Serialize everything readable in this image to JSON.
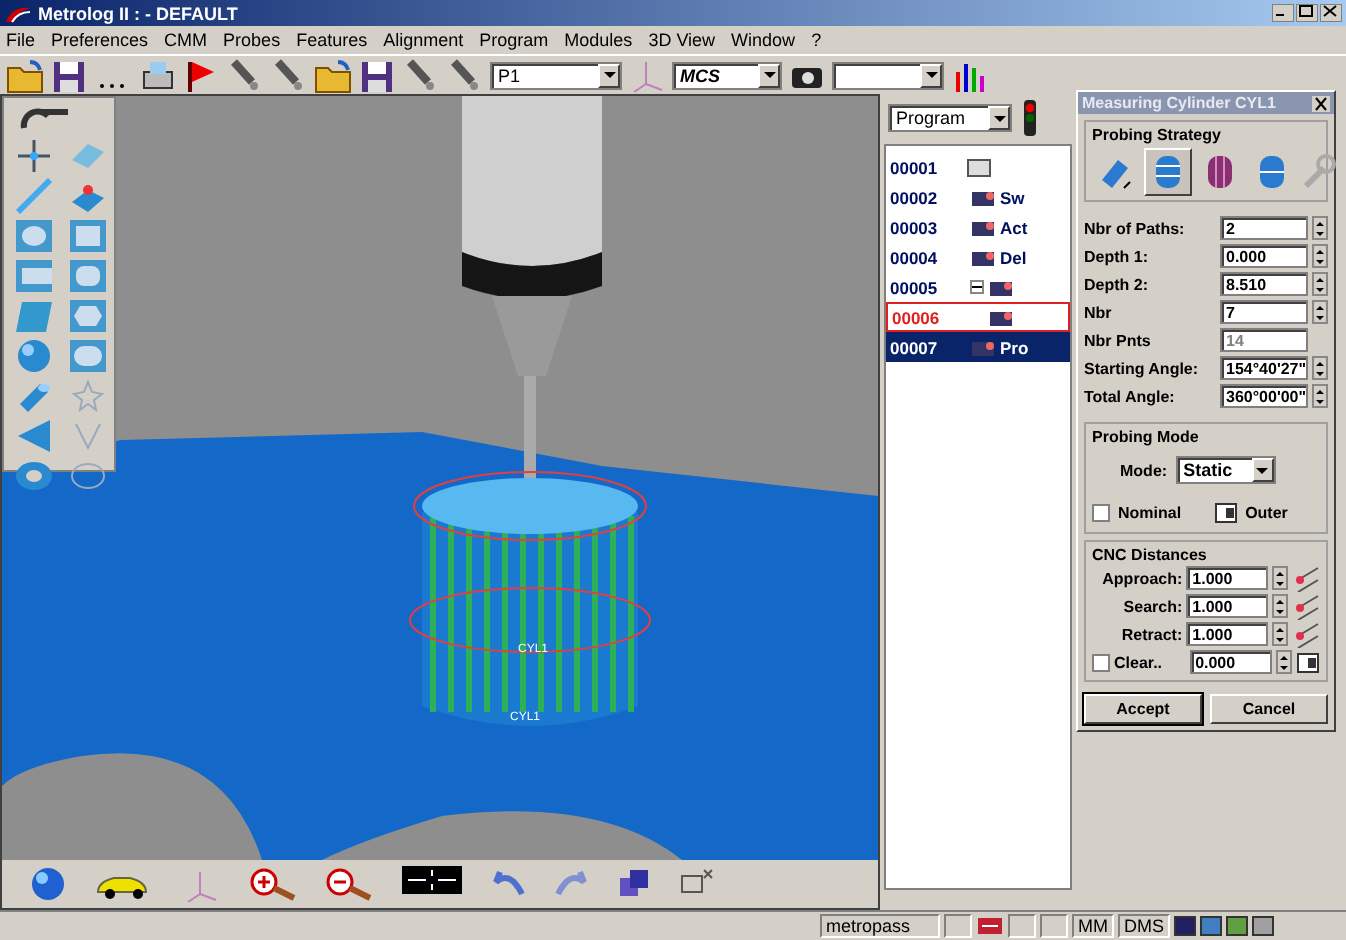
{
  "window": {
    "title": "Metrolog II : - DEFAULT"
  },
  "menu": [
    "File",
    "Preferences",
    "CMM",
    "Probes",
    "Features",
    "Alignment",
    "Program",
    "Modules",
    "3D View",
    "Window",
    "?"
  ],
  "toolbar": {
    "probe": "P1",
    "frame": "MCS"
  },
  "viewport": {
    "labels": [
      "CYL1",
      "CYL1"
    ]
  },
  "program": {
    "dropdown": "Program",
    "rows": [
      {
        "number": "00001",
        "selected": false,
        "highlighted": false,
        "children": [
          {
            "number": "00002",
            "label": "Sw",
            "selected": false,
            "highlighted": false
          },
          {
            "number": "00003",
            "label": "Act",
            "selected": false,
            "highlighted": false
          },
          {
            "number": "00004",
            "label": "Del",
            "selected": false,
            "highlighted": false
          },
          {
            "number": "00005",
            "selected": false,
            "highlighted": false,
            "expanded": true,
            "children": [
              {
                "number": "00006",
                "selected": false,
                "highlighted": true
              }
            ]
          },
          {
            "number": "00007",
            "label": "Pro",
            "selected": true,
            "highlighted": false
          }
        ]
      }
    ]
  },
  "dialog": {
    "title": "Measuring Cylinder CYL1",
    "strategy": {
      "title": "Probing Strategy",
      "options": [
        {
          "selected": false
        },
        {
          "selected": true
        },
        {
          "selected": false
        },
        {
          "selected": false
        }
      ]
    },
    "fields": [
      {
        "label": "Nbr of Paths:",
        "value": "2",
        "disabled": false
      },
      {
        "label": "Depth 1:",
        "value": "0.000",
        "disabled": false
      },
      {
        "label": "Depth 2:",
        "value": "8.510",
        "disabled": false
      },
      {
        "label": "Nbr",
        "value": "7",
        "disabled": false
      },
      {
        "label": "Nbr Pnts",
        "value": "14",
        "disabled": true
      },
      {
        "label": "Starting Angle:",
        "value": "154°40'27\"",
        "disabled": false
      },
      {
        "label": "Total Angle:",
        "value": "360°00'00\"",
        "disabled": false
      }
    ],
    "probing_mode": {
      "title": "Probing Mode",
      "mode_label": "Mode:",
      "mode": "Static",
      "nominal": {
        "label": "Nominal",
        "checked": false
      },
      "side": "Outer"
    },
    "cnc": {
      "title": "CNC Distances",
      "rows": [
        {
          "label": "Approach:",
          "value": "1.000"
        },
        {
          "label": "Search:",
          "value": "1.000"
        },
        {
          "label": "Retract:",
          "value": "1.000"
        }
      ],
      "clear": {
        "label": "Clear..",
        "checked": false,
        "value": "0.000"
      }
    },
    "buttons": [
      {
        "label": "Accept",
        "default": true
      },
      {
        "label": "Cancel",
        "default": false
      }
    ]
  },
  "status_bar": {
    "user": "metropass",
    "units": "MM",
    "angles": "DMS"
  }
}
